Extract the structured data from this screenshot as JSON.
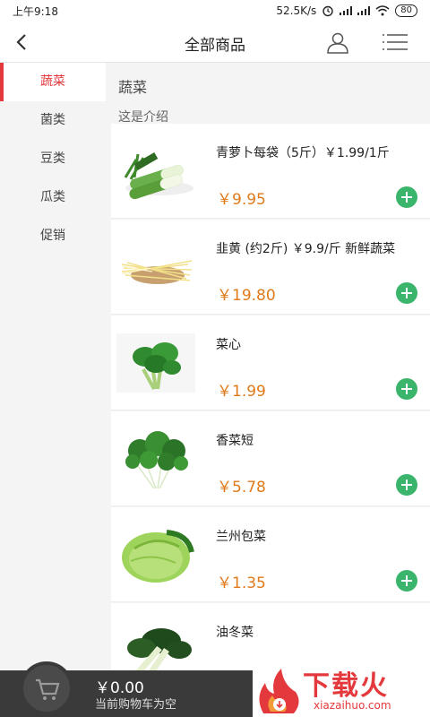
{
  "status_bar": {
    "time": "上午9:18",
    "network_speed": "52.5K/s",
    "battery": "80"
  },
  "header": {
    "title": "全部商品"
  },
  "sidebar": {
    "items": [
      {
        "label": "蔬菜"
      },
      {
        "label": "菌类"
      },
      {
        "label": "豆类"
      },
      {
        "label": "瓜类"
      },
      {
        "label": "促销"
      }
    ]
  },
  "category": {
    "title": "蔬菜",
    "description": "这是介绍"
  },
  "products": [
    {
      "name": "青萝卜每袋（5斤）￥1.99/1斤",
      "price": "￥9.95",
      "image": "radish-photo"
    },
    {
      "name": "韭黄 (约2斤) ￥9.9/斤 新鲜蔬菜",
      "price": "￥19.80",
      "image": "chive-photo"
    },
    {
      "name": "菜心",
      "price": "￥1.99",
      "image": "choy-sum-photo"
    },
    {
      "name": "香菜短",
      "price": "￥5.78",
      "image": "coriander-photo"
    },
    {
      "name": "兰州包菜",
      "price": "￥1.35",
      "image": "cabbage-photo"
    },
    {
      "name": "油冬菜",
      "price": "",
      "image": "bok-choy-photo"
    }
  ],
  "cart": {
    "total": "￥0.00",
    "status": "当前购物车为空"
  },
  "watermark": {
    "text": "下载火",
    "sub": "xiazaihuo.com"
  },
  "colors": {
    "accent": "#e4393c",
    "price": "#e07a1a",
    "add": "#3bb56b",
    "cartbar": "#3a3a3a"
  }
}
